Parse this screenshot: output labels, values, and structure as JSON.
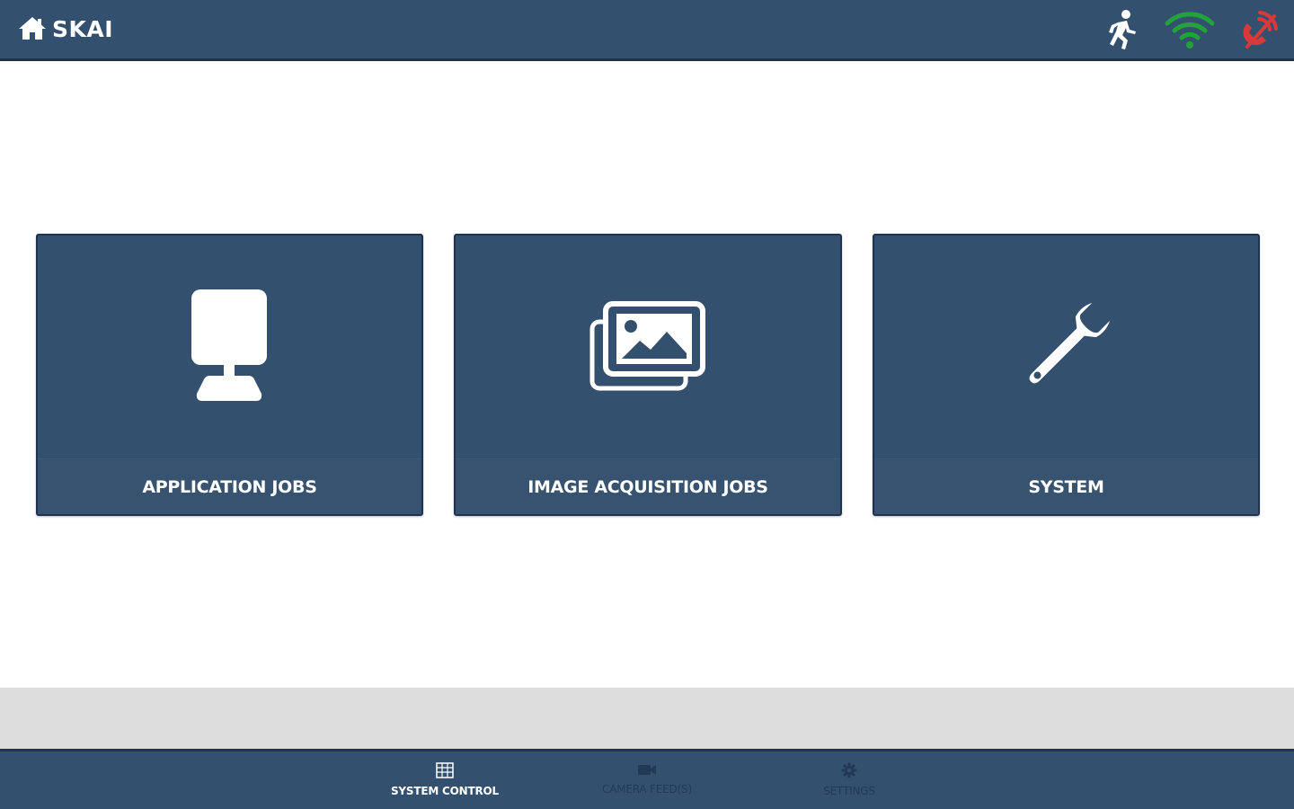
{
  "header": {
    "title": "SKAI",
    "icons": {
      "home": "home-icon",
      "activity": "running-person-icon",
      "wifi": "wifi-icon",
      "connection": "disconnected-phone-icon"
    },
    "colors": {
      "bar": "#34506f",
      "wifi": "#22a33a",
      "disconnected": "#d83a3a"
    }
  },
  "tiles": [
    {
      "label": "APPLICATION JOBS",
      "icon": "camera-device-icon"
    },
    {
      "label": "IMAGE ACQUISITION JOBS",
      "icon": "image-gallery-icon"
    },
    {
      "label": "SYSTEM",
      "icon": "wrench-icon"
    }
  ],
  "bottom_nav": {
    "items": [
      {
        "label": "SYSTEM CONTROL",
        "icon": "grid-icon",
        "active": true
      },
      {
        "label": "CAMERA FEED(S)",
        "icon": "video-camera-icon",
        "active": false
      },
      {
        "label": "SETTINGS",
        "icon": "gear-icon",
        "active": false
      }
    ]
  }
}
